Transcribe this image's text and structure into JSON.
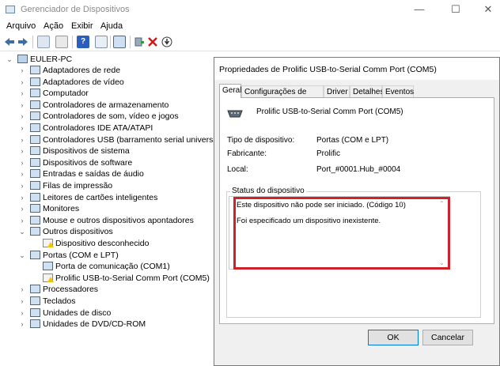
{
  "window": {
    "title": "Gerenciador de Dispositivos",
    "minimize": "—",
    "maximize": "☐",
    "close": "✕"
  },
  "menu": [
    "Arquivo",
    "Ação",
    "Exibir",
    "Ajuda"
  ],
  "tree": {
    "root": "EULER-PC",
    "items": [
      {
        "label": "Adaptadores de rede",
        "icon": "network-adapter-icon"
      },
      {
        "label": "Adaptadores de vídeo",
        "icon": "display-adapter-icon"
      },
      {
        "label": "Computador",
        "icon": "computer-icon"
      },
      {
        "label": "Controladores de armazenamento",
        "icon": "storage-controller-icon"
      },
      {
        "label": "Controladores de som, vídeo e jogos",
        "icon": "sound-icon"
      },
      {
        "label": "Controladores IDE ATA/ATAPI",
        "icon": "ide-controller-icon"
      },
      {
        "label": "Controladores USB (barramento serial universal)",
        "icon": "usb-icon"
      },
      {
        "label": "Dispositivos de sistema",
        "icon": "system-device-icon"
      },
      {
        "label": "Dispositivos de software",
        "icon": "software-device-icon"
      },
      {
        "label": "Entradas e saídas de áudio",
        "icon": "audio-io-icon"
      },
      {
        "label": "Filas de impressão",
        "icon": "print-queue-icon"
      },
      {
        "label": "Leitores de cartões inteligentes",
        "icon": "smart-card-icon"
      },
      {
        "label": "Monitores",
        "icon": "monitor-icon"
      },
      {
        "label": "Mouse e outros dispositivos apontadores",
        "icon": "mouse-icon"
      },
      {
        "label": "Outros dispositivos",
        "icon": "other-devices-icon",
        "expanded": true
      },
      {
        "label": "Dispositivo desconhecido",
        "icon": "unknown-device-warning-icon",
        "child": true
      },
      {
        "label": "Portas (COM e LPT)",
        "icon": "ports-icon",
        "expanded": true
      },
      {
        "label": "Porta de comunicação (COM1)",
        "icon": "com-port-icon",
        "child": true
      },
      {
        "label": "Prolific USB-to-Serial Comm Port (COM5)",
        "icon": "com-port-warning-icon",
        "child": true
      },
      {
        "label": "Processadores",
        "icon": "processor-icon"
      },
      {
        "label": "Teclados",
        "icon": "keyboard-icon"
      },
      {
        "label": "Unidades de disco",
        "icon": "disk-drive-icon"
      },
      {
        "label": "Unidades de DVD/CD-ROM",
        "icon": "dvd-icon"
      }
    ]
  },
  "dialog": {
    "title": "Propriedades de Prolific USB-to-Serial Comm Port (COM5)",
    "tabs": [
      "Geral",
      "Configurações de Porta",
      "Driver",
      "Detalhes",
      "Eventos"
    ],
    "device_name": "Prolific USB-to-Serial Comm Port (COM5)",
    "props": [
      {
        "label": "Tipo de dispositivo:",
        "value": "Portas (COM e LPT)"
      },
      {
        "label": "Fabricante:",
        "value": "Prolific"
      },
      {
        "label": "Local:",
        "value": "Port_#0001.Hub_#0004"
      }
    ],
    "status_title": "Status do dispositivo",
    "status_lines": [
      "Este dispositivo não pode ser iniciado. (Código 10)",
      "Foi especificado um dispositivo inexistente."
    ],
    "ok": "OK",
    "cancel": "Cancelar"
  },
  "colors": {
    "highlight": "#d0202a",
    "accent": "#0078d7"
  }
}
